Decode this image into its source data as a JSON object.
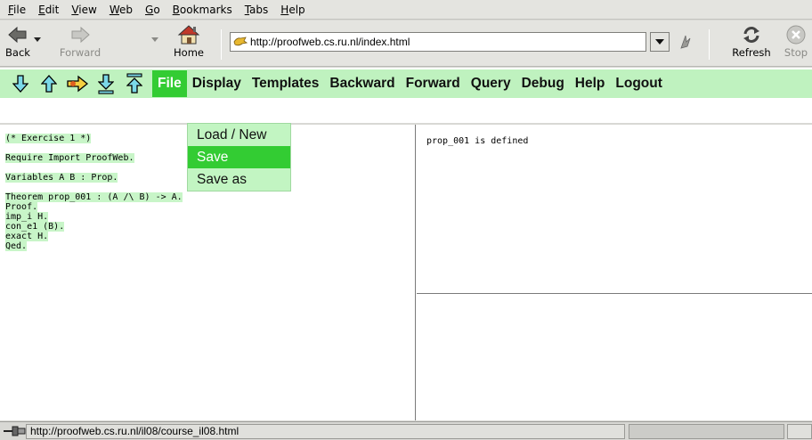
{
  "menubar": {
    "items": [
      {
        "first": "F",
        "rest": "ile"
      },
      {
        "first": "E",
        "rest": "dit"
      },
      {
        "first": "V",
        "rest": "iew"
      },
      {
        "first": "W",
        "rest": "eb"
      },
      {
        "first": "G",
        "rest": "o"
      },
      {
        "first": "B",
        "rest": "ookmarks"
      },
      {
        "first": "T",
        "rest": "abs"
      },
      {
        "first": "H",
        "rest": "elp"
      }
    ]
  },
  "navbar": {
    "back_label": "Back",
    "forward_label": "Forward",
    "home_label": "Home",
    "refresh_label": "Refresh",
    "stop_label": "Stop",
    "url": "http://proofweb.cs.ru.nl/index.html",
    "icons": {
      "back": "back-arrow-icon",
      "forward": "forward-arrow-icon",
      "home": "home-icon",
      "site": "site-favicon",
      "go": "go-icon",
      "refresh": "refresh-icon",
      "stop": "stop-icon"
    }
  },
  "proofweb_toolbar": {
    "arrow_icons": [
      "step-down-icon",
      "step-up-icon",
      "goto-cursor-icon",
      "goto-end-icon",
      "goto-start-icon"
    ],
    "menus": [
      "File",
      "Display",
      "Templates",
      "Backward",
      "Forward",
      "Query",
      "Debug",
      "Help",
      "Logout"
    ],
    "active_menu": "File",
    "colors": {
      "bar": "#bff2bf",
      "active": "#33cc33",
      "processed": "#c8f5c8"
    }
  },
  "file_dropdown": {
    "items": [
      "Load / New",
      "Save",
      "Save as"
    ],
    "highlighted": "Save"
  },
  "editor": {
    "lines": [
      "(* Exercise 1 *)",
      "",
      "Require Import ProofWeb.",
      "",
      "Variables A B : Prop.",
      "",
      "Theorem prop_001 : (A /\\ B) -> A.",
      "Proof.",
      "imp_i H.",
      "con_e1 (B).",
      "exact H.",
      "Qed."
    ]
  },
  "goals": {
    "text": "prop_001 is defined"
  },
  "statusbar": {
    "text": "http://proofweb.cs.ru.nl/il08/course_il08.html"
  }
}
